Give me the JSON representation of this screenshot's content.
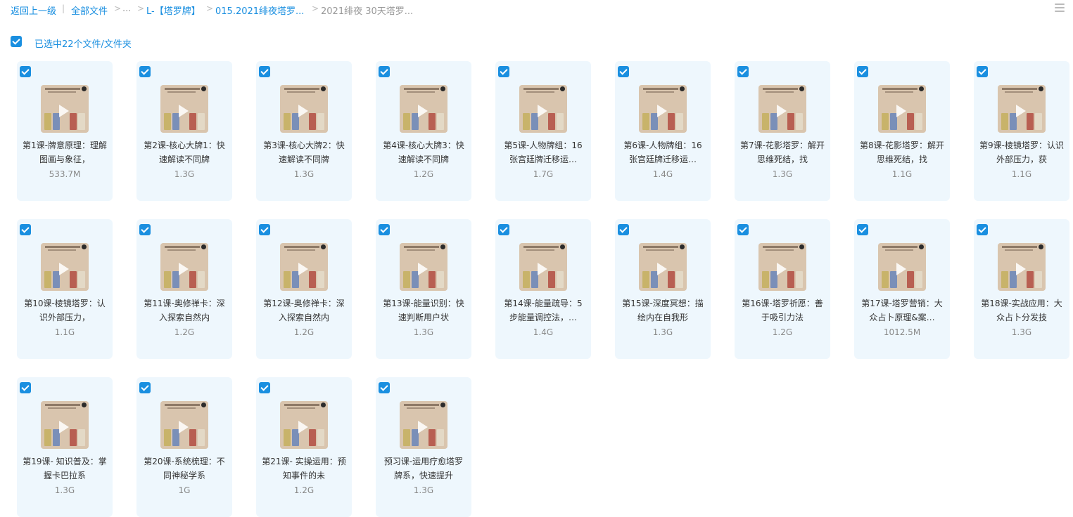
{
  "breadcrumb": {
    "back": "返回上一级",
    "all_files": "全部文件",
    "ellipsis": "...",
    "folder1": "L-【塔罗牌】",
    "folder2": "015.2021绯夜塔罗...",
    "current": "2021绯夜 30天塔罗..."
  },
  "icons": {
    "list_view": "list-view-icon",
    "check": "checkbox-checked-icon"
  },
  "accent": "#1a8fe0",
  "selection": {
    "label": "已选中22个文件/文件夹"
  },
  "files": [
    {
      "title": "第1课-牌意原理：理解图画与象征，",
      "size": "533.7M"
    },
    {
      "title": "第2课-核心大牌1：快速解读不同牌",
      "size": "1.3G"
    },
    {
      "title": "第3课-核心大牌2：快速解读不同牌",
      "size": "1.3G"
    },
    {
      "title": "第4课-核心大牌3：快速解读不同牌",
      "size": "1.2G"
    },
    {
      "title": "第5课-人物牌组：16张宫廷牌迁移运…",
      "size": "1.7G"
    },
    {
      "title": "第6课-人物牌组：16张宫廷牌迁移运…",
      "size": "1.4G"
    },
    {
      "title": "第7课-花影塔罗：解开思维死结，找",
      "size": "1.3G"
    },
    {
      "title": "第8课-花影塔罗：解开思维死结，找",
      "size": "1.1G"
    },
    {
      "title": "第9课-棱镜塔罗：认识外部压力，获",
      "size": "1.1G"
    },
    {
      "title": "第10课-棱镜塔罗：认识外部压力，",
      "size": "1.1G"
    },
    {
      "title": "第11课-奥修禅卡：深入探索自然内",
      "size": "1.2G"
    },
    {
      "title": "第12课-奥修禅卡：深入探索自然内",
      "size": "1.2G"
    },
    {
      "title": "第13课-能量识别：快速判断用户状",
      "size": "1.3G"
    },
    {
      "title": "第14课-能量疏导：5步能量调控法，…",
      "size": "1.4G"
    },
    {
      "title": "第15课-深度冥想：描绘内在自我形",
      "size": "1.3G"
    },
    {
      "title": "第16课-塔罗祈愿：善于吸引力法",
      "size": "1.2G"
    },
    {
      "title": "第17课-塔罗营销：大众占卜原理&案…",
      "size": "1012.5M"
    },
    {
      "title": "第18课-实战应用：大众占卜分发技",
      "size": "1.3G"
    },
    {
      "title": "第19课- 知识普及：掌握卡巴拉系",
      "size": "1.3G"
    },
    {
      "title": "第20课-系统梳理：不同神秘学系",
      "size": "1G"
    },
    {
      "title": "第21课- 实操运用：预知事件的未",
      "size": "1.2G"
    },
    {
      "title": "预习课-运用疗愈塔罗牌系，快速提升",
      "size": "1.3G"
    }
  ]
}
